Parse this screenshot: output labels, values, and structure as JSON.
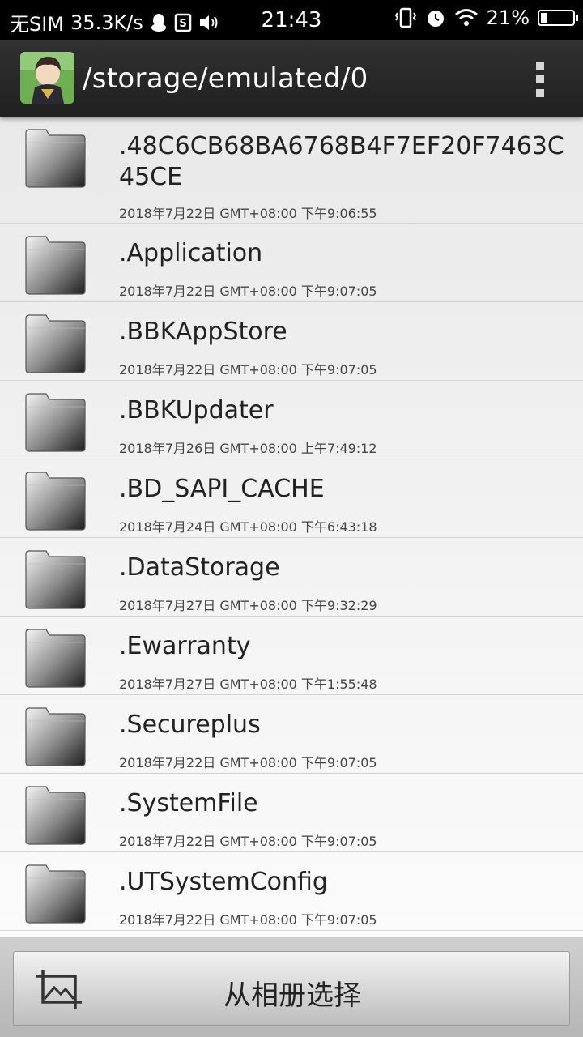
{
  "status_bar": {
    "carrier": "无SIM",
    "speed": "35.3K/s",
    "time": "21:43",
    "battery": "21%",
    "battery_level": 0.21
  },
  "header": {
    "path": "/storage/emulated/0"
  },
  "files": [
    {
      "name": ".48C6CB68BA6768B4F7EF20F7463C45CE",
      "date": "2018年7月22日 GMT+08:00 下午9:06:55"
    },
    {
      "name": ".Application",
      "date": "2018年7月22日 GMT+08:00 下午9:07:05"
    },
    {
      "name": ".BBKAppStore",
      "date": "2018年7月22日 GMT+08:00 下午9:07:05"
    },
    {
      "name": ".BBKUpdater",
      "date": "2018年7月26日 GMT+08:00 上午7:49:12"
    },
    {
      "name": ".BD_SAPI_CACHE",
      "date": "2018年7月24日 GMT+08:00 下午6:43:18"
    },
    {
      "name": ".DataStorage",
      "date": "2018年7月27日 GMT+08:00 下午9:32:29"
    },
    {
      "name": ".Ewarranty",
      "date": "2018年7月27日 GMT+08:00 下午1:55:48"
    },
    {
      "name": ".Secureplus",
      "date": "2018年7月22日 GMT+08:00 下午9:07:05"
    },
    {
      "name": ".SystemFile",
      "date": "2018年7月22日 GMT+08:00 下午9:07:05"
    },
    {
      "name": ".UTSystemConfig",
      "date": "2018年7月22日 GMT+08:00 下午9:07:05"
    }
  ],
  "bottom_bar": {
    "album_button_label": "从相册选择"
  }
}
